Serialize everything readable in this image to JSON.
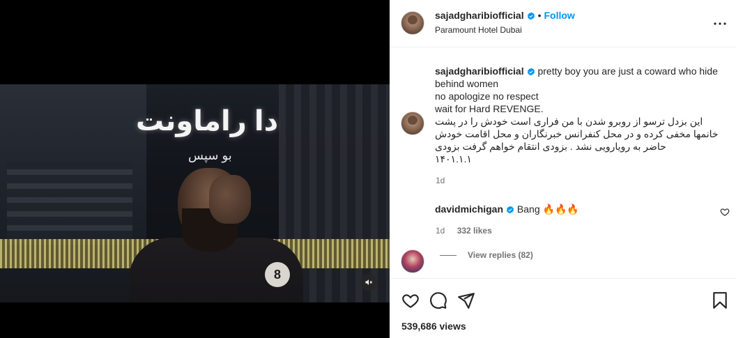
{
  "media": {
    "sign_text": "دا راماونت",
    "sign_sub_text": "بو سپس",
    "mute_icon": "speaker-muted-icon"
  },
  "header": {
    "username": "sajadgharibiofficial",
    "separator": "•",
    "follow_label": "Follow",
    "location": "Paramount Hotel Dubai",
    "more_icon": "more-horizontal-icon"
  },
  "caption": {
    "username": "sajadgharibiofficial",
    "line1": "pretty boy you are just a coward who hide behind women",
    "line2": "no apologize no respect",
    "line3": "wait for Hard REVENGE.",
    "line4": "این بزدل ترسو از روبرو شدن با من فراری است خودش را در پشت خانمها مخفی کرده و در محل کنفرانس خبرنگاران و محل اقامت خودش حاضر به رویارویی نشد . بزودی انتقام خواهم گرفت بزودی",
    "line5": "۱۴۰۱.۱.۱",
    "time": "1d"
  },
  "comments": [
    {
      "username": "davidmichigan",
      "text": "Bang 🔥🔥🔥",
      "time": "1d",
      "likes": "332 likes",
      "view_replies": "View replies (82)"
    }
  ],
  "actions": {
    "icons": [
      "heart-icon",
      "comment-icon",
      "share-icon",
      "bookmark-icon"
    ],
    "views": "539,686 views"
  },
  "colors": {
    "accent": "#0095f6",
    "verified": "#0095f6",
    "text": "#262626",
    "secondary": "#737373"
  }
}
